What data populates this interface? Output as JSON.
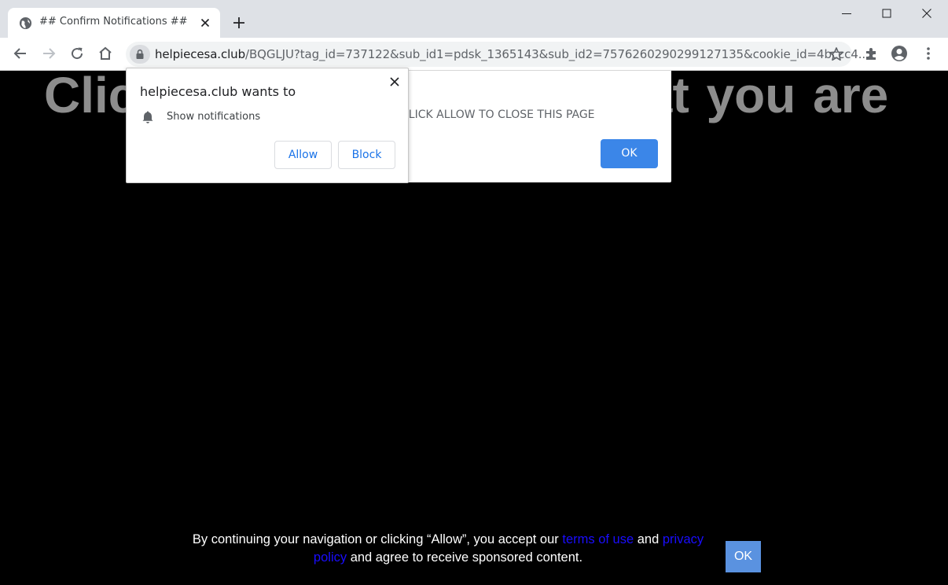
{
  "browser": {
    "tab_title": "## Confirm Notifications ##",
    "url_host": "helpiecesa.club",
    "url_path": "/BQGLJU?tag_id=737122&sub_id1=pdsk_1365143&sub_id2=7576260290299127135&cookie_id=4bccc4..."
  },
  "page": {
    "headline": "Click Allow to confirm that you are",
    "alert_message": "CLICK ALLOW TO CLOSE THIS PAGE",
    "alert_ok": "OK",
    "footer": {
      "text_1": "By continuing your navigation or clicking “Allow”, you accept our ",
      "terms_link": "terms of use",
      "text_2": " and ",
      "privacy_link": "privacy policy",
      "text_3": " and agree to receive sponsored content."
    },
    "footer_ok": "OK"
  },
  "permission_prompt": {
    "title": "helpiecesa.club wants to",
    "permission": "Show notifications",
    "allow": "Allow",
    "block": "Block"
  },
  "colors": {
    "accent_blue": "#1a73e8",
    "alert_ok_bg": "#3b86e8",
    "footer_ok_bg": "#5a92e0",
    "link_blue": "#1a0dff",
    "headline_grey": "#8d8d8d"
  }
}
